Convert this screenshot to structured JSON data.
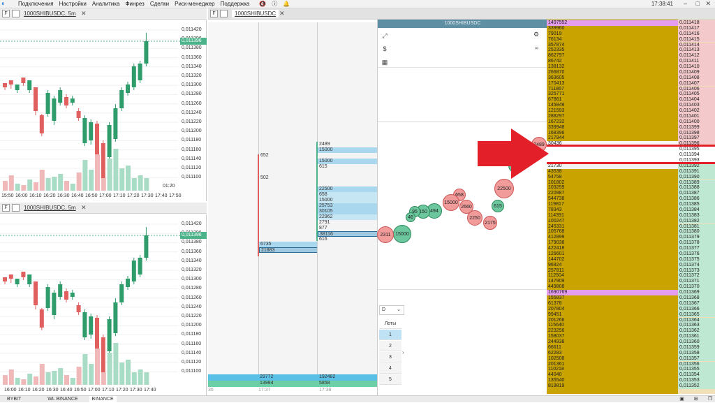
{
  "menu": {
    "items": [
      "Подключения",
      "Настройки",
      "Аналитика",
      "Финрез",
      "Сделки",
      "Риск-менеджер",
      "Поддержка"
    ],
    "clock": "17:38:41"
  },
  "chart1": {
    "tab_letter": "F",
    "title": "1000SHIBUSDC, 5m",
    "price_labels": [
      "0,011420",
      "0,011396",
      "0,011380",
      "0,011360",
      "0,011340",
      "0,011320",
      "0,011300",
      "0,011280",
      "0,011260",
      "0,011240",
      "0,011220",
      "0,011200",
      "0,011180",
      "0,011160",
      "0,011140",
      "0,011120",
      "0,011100"
    ],
    "current_price": "0,011396",
    "countdown": "01:20",
    "time_labels": [
      "15:50",
      "16:00",
      "16:10",
      "16:20",
      "16:30",
      "16:40",
      "16:50",
      "17:00",
      "17:10",
      "17:20",
      "17:30",
      "17:40",
      "17:50"
    ]
  },
  "chart2": {
    "tab_letter": "F",
    "title": "1000SHIBUSDC, 5m",
    "price_labels": [
      "0,011420",
      "0,011396",
      "0,011380",
      "0,011360",
      "0,011340",
      "0,011320",
      "0,011300",
      "0,011280",
      "0,011260",
      "0,011240",
      "0,011220",
      "0,011200",
      "0,011180",
      "0,011160",
      "0,011140",
      "0,011120",
      "0,011100"
    ],
    "current_price": "0,011396",
    "time_labels": [
      "16:00",
      "16:10",
      "16:20",
      "16:30",
      "16:40",
      "16:50",
      "17:00",
      "17:10",
      "17:20",
      "17:30",
      "17:40"
    ]
  },
  "dom": {
    "tab_letter": "F",
    "title": "1000SHIBUSDC",
    "header_symbol": "1000SHIBUSDC",
    "col1": [
      "652",
      "502",
      "6735",
      "21883"
    ],
    "col2": [
      "2489",
      "15000",
      "15000",
      "615",
      "22500",
      "658",
      "15000",
      "25753",
      "30105",
      "22962",
      "2791",
      "877",
      "38116",
      "616"
    ],
    "col1_footer_top": "29772",
    "col1_footer_bottom": "13994",
    "col2_footer_top": "192482",
    "col2_footer_bottom": "5858",
    "time_a": "17:37",
    "time_b": "17:38",
    "left_edge_label": "36",
    "timeframe": "D",
    "lots_label": "Лоты",
    "lots": [
      "1",
      "2",
      "3",
      "4",
      "5"
    ],
    "bubbles": [
      "2489",
      "22500",
      "615",
      "2175",
      "2250",
      "658",
      "2660",
      "15000",
      "494",
      "150",
      "95",
      "46",
      "15000",
      "2311"
    ]
  },
  "ladder": {
    "rows": [
      [
        "1497552",
        "0,011418"
      ],
      [
        "339960",
        "0,011417"
      ],
      [
        "79019",
        "0,011416"
      ],
      [
        "76134",
        "0,011415"
      ],
      [
        "357874",
        "0,011414"
      ],
      [
        "252335",
        "0,011413"
      ],
      [
        "862797",
        "0,011412"
      ],
      [
        "86742",
        "0,011411"
      ],
      [
        "138132",
        "0,011410"
      ],
      [
        "266870",
        "0,011409"
      ],
      [
        "363605",
        "0,011408"
      ],
      [
        "170413",
        "0,011407"
      ],
      [
        "711867",
        "0,011406"
      ],
      [
        "325771",
        "0,011405"
      ],
      [
        "67861",
        "0,011404"
      ],
      [
        "145849",
        "0,011403"
      ],
      [
        "121593",
        "0,011402"
      ],
      [
        "288297",
        "0,011401"
      ],
      [
        "167232",
        "0,011400"
      ],
      [
        "339948",
        "0,011399"
      ],
      [
        "168396",
        "0,011398"
      ],
      [
        "217944",
        "0,011397"
      ],
      [
        "30436",
        "0,011396"
      ],
      [
        "",
        "0,011395"
      ],
      [
        "",
        "0,011394"
      ],
      [
        "",
        "0,011393"
      ],
      [
        "21730",
        "0,011392"
      ],
      [
        "43538",
        "0,011391"
      ],
      [
        "54758",
        "0,011390"
      ],
      [
        "101802",
        "0,011389"
      ],
      [
        "103259",
        "0,011388"
      ],
      [
        "220987",
        "0,011387"
      ],
      [
        "544738",
        "0,011386"
      ],
      [
        "119817",
        "0,011385"
      ],
      [
        "78343",
        "0,011384"
      ],
      [
        "114391",
        "0,011383"
      ],
      [
        "100247",
        "0,011382"
      ],
      [
        "245331",
        "0,011381"
      ],
      [
        "105768",
        "0,011380"
      ],
      [
        "412899",
        "0,011379"
      ],
      [
        "179038",
        "0,011378"
      ],
      [
        "422418",
        "0,011377"
      ],
      [
        "126601",
        "0,011376"
      ],
      [
        "144702",
        "0,011375"
      ],
      [
        "96924",
        "0,011374"
      ],
      [
        "257811",
        "0,011373"
      ],
      [
        "112504",
        "0,011372"
      ],
      [
        "147909",
        "0,011371"
      ],
      [
        "449808",
        "0,011370"
      ],
      [
        "1690769",
        "0,011369"
      ],
      [
        "155837",
        "0,011368"
      ],
      [
        "61378",
        "0,011367"
      ],
      [
        "207804",
        "0,011366"
      ],
      [
        "99451",
        "0,011365"
      ],
      [
        "201266",
        "0,011364"
      ],
      [
        "115640",
        "0,011363"
      ],
      [
        "223256",
        "0,011362"
      ],
      [
        "158037",
        "0,011361"
      ],
      [
        "244938",
        "0,011360"
      ],
      [
        "66611",
        "0,011359"
      ],
      [
        "62283",
        "0,011358"
      ],
      [
        "102508",
        "0,011357"
      ],
      [
        "201361",
        "0,011356"
      ],
      [
        "110218",
        "0,011355"
      ],
      [
        "44040",
        "0,011354"
      ],
      [
        "135540",
        "0,011353"
      ],
      [
        "819819",
        "0,011352"
      ]
    ]
  },
  "bottom": {
    "tabs": [
      "BYBIT",
      "WL BINANCE",
      "BINANCE"
    ]
  },
  "colors": {
    "bull": "#2e9c6b",
    "bear": "#e06060",
    "ladder_bg": "#c9a400",
    "accent": "#4cb28a",
    "arrow": "#e3202a"
  }
}
